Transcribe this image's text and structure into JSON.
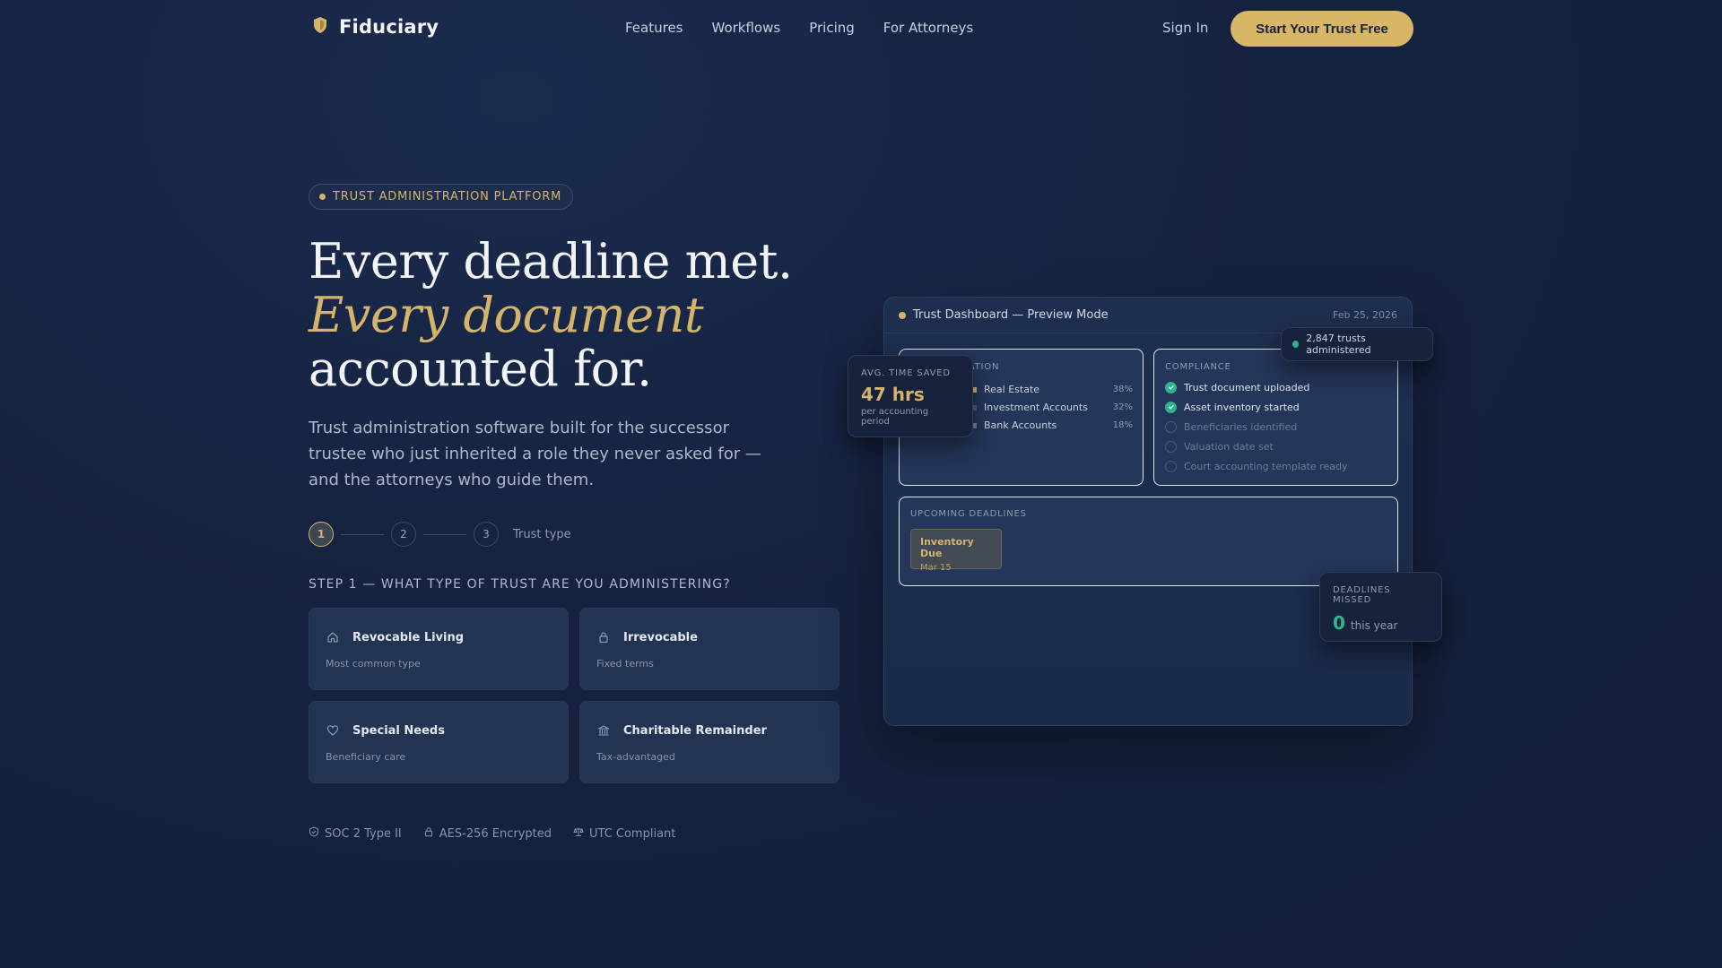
{
  "nav": {
    "brand": "Fiduciary",
    "links": [
      "Features",
      "Workflows",
      "Pricing",
      "For Attorneys"
    ],
    "sign_in": "Sign In",
    "cta": "Start Your Trust Free"
  },
  "hero": {
    "badge": "TRUST ADMINISTRATION PLATFORM",
    "headline_line1": "Every deadline met.",
    "headline_line2": "Every document",
    "headline_line3": "accounted for.",
    "subcopy": "Trust administration software built for the successor trustee who just inherited a role they never asked for — and the attorneys who guide them."
  },
  "stepper": {
    "steps": [
      "1",
      "2",
      "3"
    ],
    "active_step": 1,
    "label": "Trust type",
    "title": "STEP 1 — WHAT TYPE OF TRUST ARE YOU ADMINISTERING?"
  },
  "trust_types": [
    {
      "title": "Revocable Living",
      "subtitle": "Most common type",
      "icon": "home-icon"
    },
    {
      "title": "Irrevocable",
      "subtitle": "Fixed terms",
      "icon": "lock-icon"
    },
    {
      "title": "Special Needs",
      "subtitle": "Beneficiary care",
      "icon": "heart-icon"
    },
    {
      "title": "Charitable Remainder",
      "subtitle": "Tax-advantaged",
      "icon": "bank-icon"
    }
  ],
  "trust_badges": [
    {
      "label": "SOC 2 Type II",
      "icon": "shield-check-icon"
    },
    {
      "label": "AES-256 Encrypted",
      "icon": "lock-icon"
    },
    {
      "label": "UTC Compliant",
      "icon": "scales-icon"
    }
  ],
  "dashboard": {
    "title": "Trust Dashboard — Preview Mode",
    "date": "Feb 25, 2026",
    "allocation": {
      "title": "CATION",
      "items": [
        {
          "label": "Real Estate",
          "pct": "38%",
          "color": "#d4b36a"
        },
        {
          "label": "Investment Accounts",
          "pct": "32%",
          "color": "#4f5d78"
        },
        {
          "label": "Bank Accounts",
          "pct": "18%",
          "color": "#6f7d98"
        }
      ]
    },
    "compliance": {
      "title": "COMPLIANCE",
      "items": [
        {
          "label": "Trust document uploaded",
          "done": true
        },
        {
          "label": "Asset inventory started",
          "done": true
        },
        {
          "label": "Beneficiaries identified",
          "done": false
        },
        {
          "label": "Valuation date set",
          "done": false
        },
        {
          "label": "Court accounting template ready",
          "done": false
        }
      ]
    },
    "deadlines": {
      "title": "UPCOMING DEADLINES",
      "items": [
        {
          "title": "Inventory Due",
          "date": "Mar 15"
        }
      ]
    }
  },
  "floating": {
    "time_saved": {
      "label": "AVG. TIME SAVED",
      "value": "47 hrs",
      "sub": "per accounting period"
    },
    "trusts": "2,847 trusts administered",
    "missed": {
      "label": "DEADLINES MISSED",
      "value": "0",
      "sub": "this year"
    }
  },
  "colors": {
    "accent": "#d4b36a",
    "success": "#2bb58c",
    "background": "#15223f"
  }
}
